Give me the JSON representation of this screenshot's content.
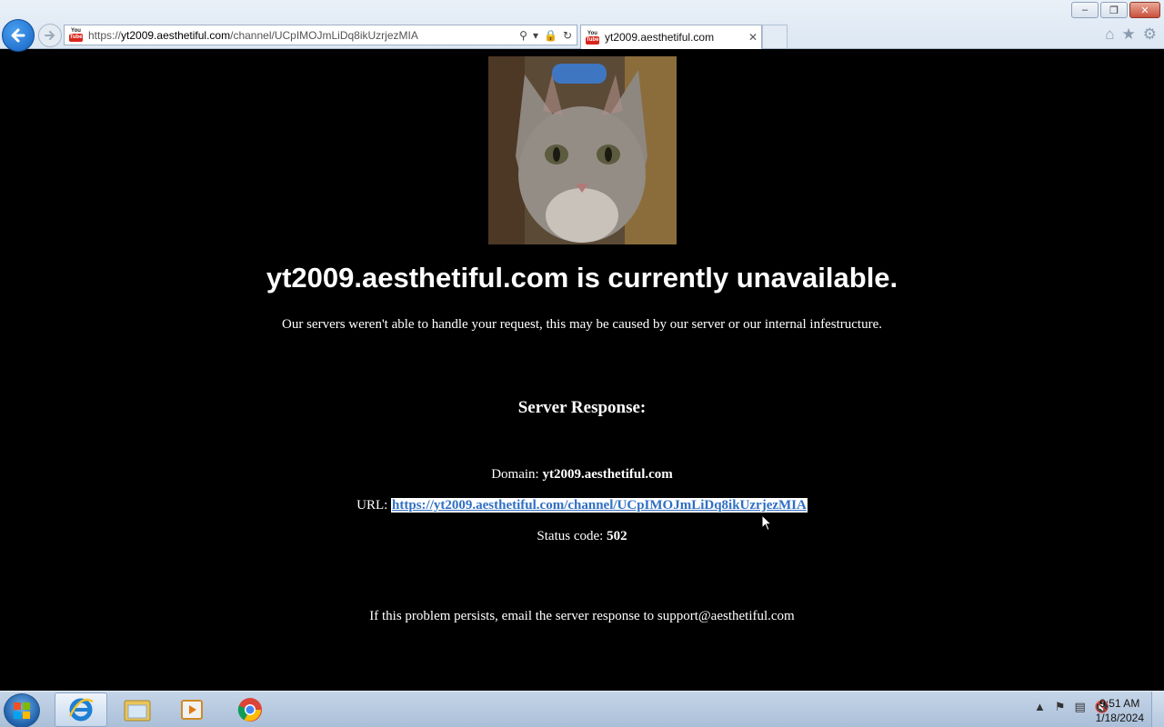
{
  "browser": {
    "address_url": "https://yt2009.aesthetiful.com/channel/UCpIMOJmLiDq8ikUzrjezMIA",
    "address_prefix": "https://",
    "address_host": "yt2009.aesthetiful.com",
    "address_path": "/channel/UCpIMOJmLiDq8ikUzrjezMIA",
    "tab_title": "yt2009.aesthetiful.com",
    "favicon_top": "You",
    "favicon_bottom": "Tube"
  },
  "page": {
    "headline": "yt2009.aesthetiful.com is currently unavailable.",
    "subtext": "Our servers weren't able to handle your request, this may be caused by our server or our internal infestructure.",
    "response_title": "Server Response:",
    "domain_label": "Domain:",
    "domain_value": "yt2009.aesthetiful.com",
    "url_label": "URL:",
    "url_value": "https://yt2009.aesthetiful.com/channel/UCpIMOJmLiDq8ikUzrjezMIA",
    "status_label": "Status code:",
    "status_value": "502",
    "help_text": "If this problem persists, email the server response to support@aesthetiful.com"
  },
  "taskbar": {
    "time": "9:51 AM",
    "date": "1/18/2024",
    "apps": [
      "internet-explorer",
      "file-explorer",
      "media-player",
      "chrome"
    ]
  },
  "colors": {
    "page_bg": "#000000",
    "link": "#2f6fc4",
    "chrome_bg": "#dce7f3"
  }
}
